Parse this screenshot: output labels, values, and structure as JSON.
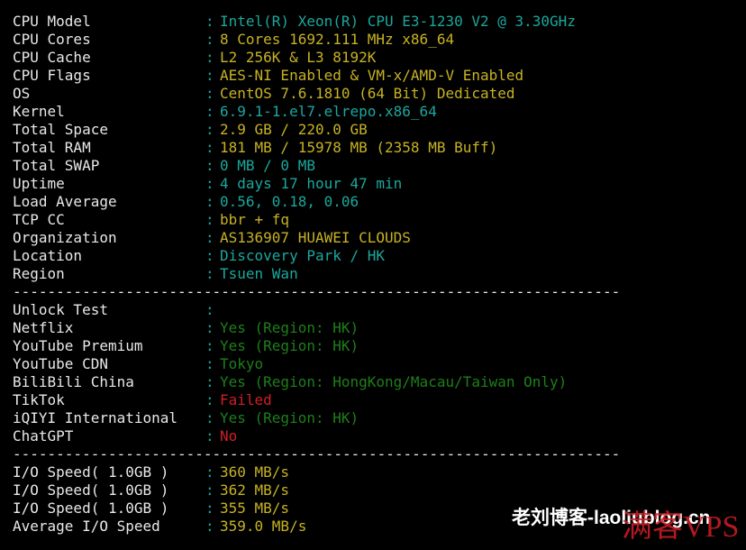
{
  "colors": {
    "background": "#000000",
    "label": "#e8e8e8",
    "colon": "#1aa89c",
    "cyan": "#1aa89c",
    "yellow": "#c7b223",
    "green": "#1e7f1a",
    "red": "#d21e26"
  },
  "system_info": [
    {
      "label": "CPU Model",
      "value": "Intel(R) Xeon(R) CPU E3-1230 V2 @ 3.30GHz",
      "color": "#1aa89c"
    },
    {
      "label": "CPU Cores",
      "value": "8 Cores 1692.111 MHz x86_64",
      "color": "#c7b223"
    },
    {
      "label": "CPU Cache",
      "value": "L2 256K & L3 8192K",
      "color": "#c7b223"
    },
    {
      "label": "CPU Flags",
      "value": "AES-NI Enabled & VM-x/AMD-V Enabled",
      "color": "#c7b223"
    },
    {
      "label": "OS",
      "value": "CentOS 7.6.1810 (64 Bit) Dedicated",
      "color": "#c7b223"
    },
    {
      "label": "Kernel",
      "value": "6.9.1-1.el7.elrepo.x86_64",
      "color": "#1aa89c"
    },
    {
      "label": "Total Space",
      "value": "2.9 GB / 220.0 GB",
      "color": "#c7b223"
    },
    {
      "label": "Total RAM",
      "value": "181 MB / 15978 MB (2358 MB Buff)",
      "color": "#c7b223"
    },
    {
      "label": "Total SWAP",
      "value": "0 MB / 0 MB",
      "color": "#1aa89c"
    },
    {
      "label": "Uptime",
      "value": "4 days 17 hour 47 min",
      "color": "#1aa89c"
    },
    {
      "label": "Load Average",
      "value": "0.56, 0.18, 0.06",
      "color": "#1aa89c"
    },
    {
      "label": "TCP CC",
      "value": "bbr + fq",
      "color": "#c7b223"
    },
    {
      "label": "Organization",
      "value": "AS136907 HUAWEI CLOUDS",
      "color": "#c7b223"
    },
    {
      "label": "Location",
      "value": "Discovery Park / HK",
      "color": "#1aa89c"
    },
    {
      "label": "Region",
      "value": "Tsuen Wan",
      "color": "#1aa89c"
    }
  ],
  "separator": "----------------------------------------------------------------------",
  "unlock_test": [
    {
      "label": "Unlock Test",
      "value": "",
      "color": "#1aa89c"
    },
    {
      "label": "Netflix",
      "value": "Yes (Region: HK)",
      "color": "#1e7f1a"
    },
    {
      "label": "YouTube Premium",
      "value": "Yes (Region: HK)",
      "color": "#1e7f1a"
    },
    {
      "label": "YouTube CDN",
      "value": "Tokyo",
      "color": "#1e7f1a"
    },
    {
      "label": "BiliBili China",
      "value": "Yes (Region: HongKong/Macau/Taiwan Only)",
      "color": "#1e7f1a"
    },
    {
      "label": "TikTok",
      "value": "Failed",
      "color": "#d21e26"
    },
    {
      "label": "iQIYI International",
      "value": "Yes (Region: HK)",
      "color": "#1e7f1a"
    },
    {
      "label": "ChatGPT",
      "value": "No",
      "color": "#d21e26"
    }
  ],
  "io_speed": [
    {
      "label": "I/O Speed( 1.0GB )",
      "value": "360 MB/s",
      "color": "#c7b223"
    },
    {
      "label": "I/O Speed( 1.0GB )",
      "value": "362 MB/s",
      "color": "#c7b223"
    },
    {
      "label": "I/O Speed( 1.0GB )",
      "value": "355 MB/s",
      "color": "#c7b223"
    },
    {
      "label": "Average I/O Speed",
      "value": "359.0 MB/s",
      "color": "#c7b223"
    }
  ],
  "watermark": {
    "site": "老刘博客-laoliublog.cn",
    "brand": "满客VPS"
  }
}
